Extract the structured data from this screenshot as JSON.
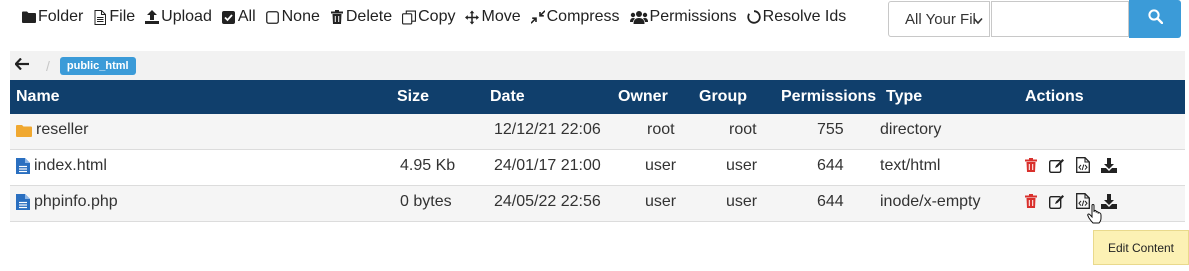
{
  "toolbar": {
    "buttons": [
      {
        "label": "Folder",
        "icon": "folder-icon"
      },
      {
        "label": "File",
        "icon": "file-icon"
      },
      {
        "label": "Upload",
        "icon": "upload-icon"
      },
      {
        "label": "All",
        "icon": "checked-checkbox-icon"
      },
      {
        "label": "None",
        "icon": "empty-checkbox-icon"
      },
      {
        "label": "Delete",
        "icon": "trash-icon"
      },
      {
        "label": "Copy",
        "icon": "copy-icon"
      },
      {
        "label": "Move",
        "icon": "move-arrows-icon"
      },
      {
        "label": "Compress",
        "icon": "compress-icon"
      },
      {
        "label": "Permissions",
        "icon": "users-icon"
      },
      {
        "label": "Resolve Ids",
        "icon": "circle-notch-icon"
      }
    ]
  },
  "search": {
    "scope_selected": "All Your Files",
    "query": "",
    "button_icon": "search-icon",
    "button_color": "#3b9bd8"
  },
  "breadcrumb": {
    "back_icon": "arrow-left-icon",
    "separator": "/",
    "current": "public_html"
  },
  "table": {
    "header_color": "#103f6c",
    "columns": {
      "name": "Name",
      "size": "Size",
      "date": "Date",
      "owner": "Owner",
      "group": "Group",
      "permissions": "Permissions",
      "type": "Type",
      "actions": "Actions"
    },
    "rows": [
      {
        "icon": "folder-icon",
        "name": "reseller",
        "size": "",
        "date": "12/12/21 22:06",
        "owner": "root",
        "group": "root",
        "permissions": "755",
        "type": "directory",
        "actions": false
      },
      {
        "icon": "file-icon",
        "name": "index.html",
        "size": "4.95 Kb",
        "date": "24/01/17 21:00",
        "owner": "user",
        "group": "user",
        "permissions": "644",
        "type": "text/html",
        "actions": true
      },
      {
        "icon": "file-icon",
        "name": "phpinfo.php",
        "size": "0 bytes",
        "date": "24/05/22 22:56",
        "owner": "user",
        "group": "user",
        "permissions": "644",
        "type": "inode/x-empty",
        "actions": true
      }
    ],
    "row_actions": [
      "trash-icon",
      "edit-icon",
      "code-file-icon",
      "download-icon"
    ]
  },
  "tooltip": {
    "text": "Edit Content"
  }
}
